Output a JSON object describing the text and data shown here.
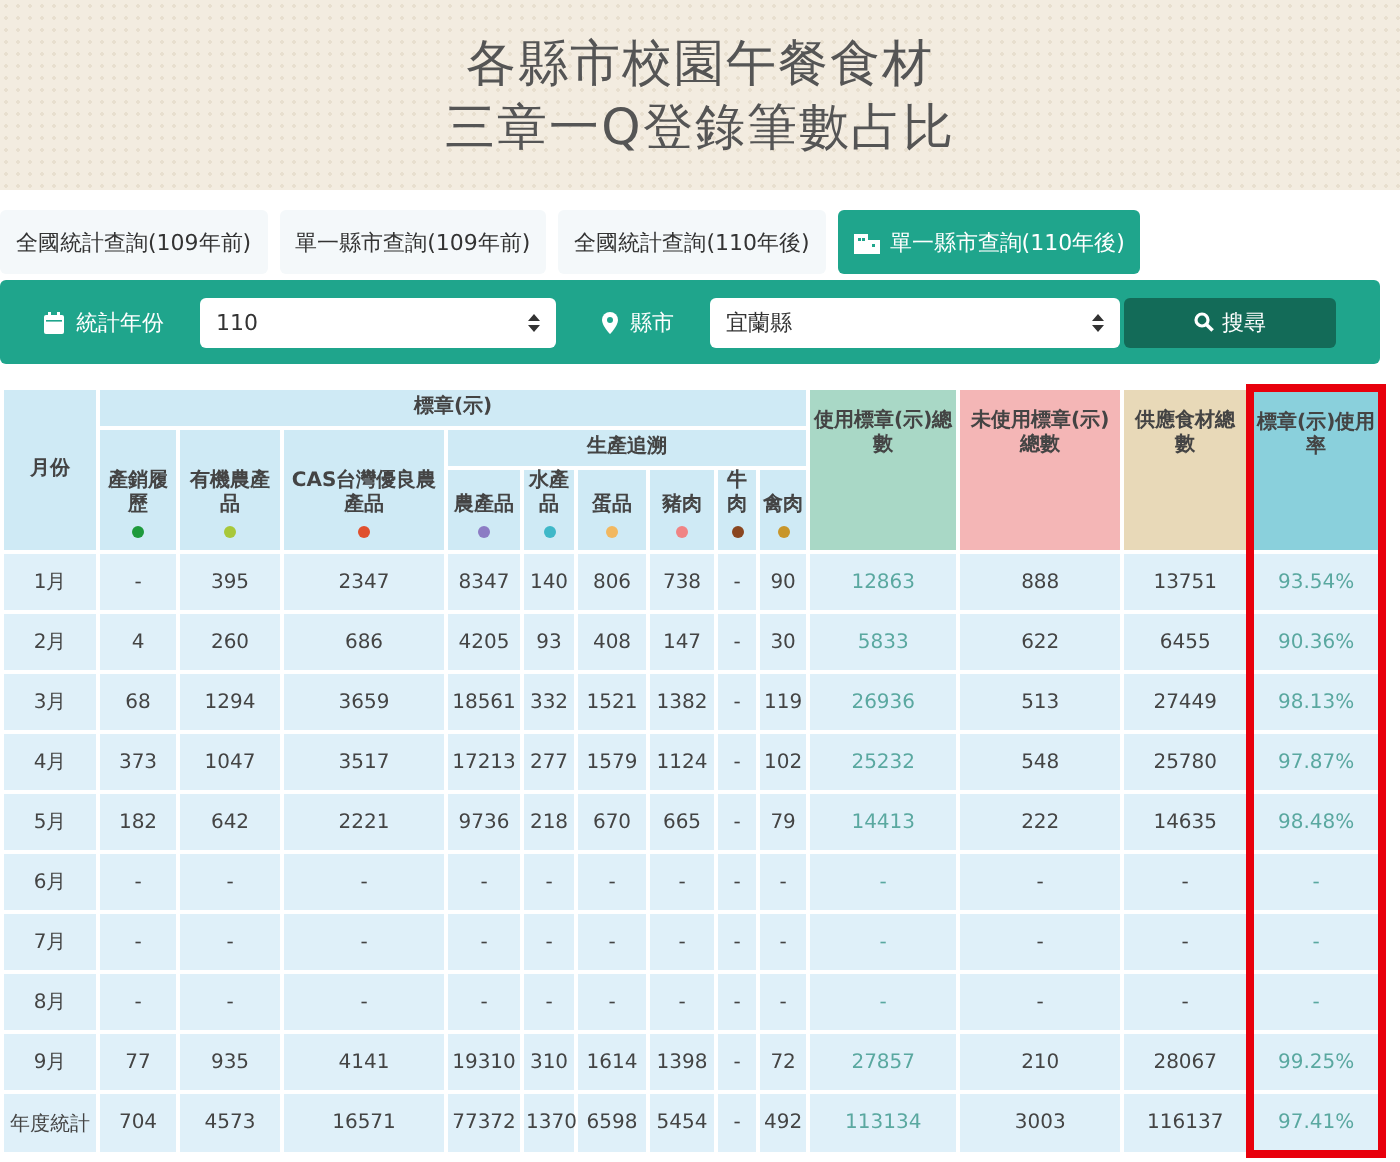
{
  "banner": {
    "title_lines": [
      "各縣市校園午餐食材",
      "三章一Q登錄筆數占比"
    ]
  },
  "tabs": [
    {
      "label": "全國統計查詢(109年前)",
      "selected": false
    },
    {
      "label": "單一縣市查詢(109年前)",
      "selected": false
    },
    {
      "label": "全國統計查詢(110年後)",
      "selected": false
    },
    {
      "label": "單一縣市查詢(110年後)",
      "selected": true
    }
  ],
  "filter": {
    "year_label": "統計年份",
    "year_value": "110",
    "county_label": "縣市",
    "county_value": "宜蘭縣",
    "search_button": "搜尋"
  },
  "table": {
    "month_heading": "月份",
    "group_heading": "標章(示)",
    "subgroup_heading": "生產追溯",
    "label_columns": [
      {
        "name": "產銷履歷",
        "color": "#1e9a3c"
      },
      {
        "name": "有機農產品",
        "color": "#a8c83a"
      },
      {
        "name": "CAS台灣優良農產品",
        "color": "#e0502e"
      }
    ],
    "trace_columns": [
      {
        "name": "農產品",
        "color": "#8c7cc4"
      },
      {
        "name": "水產品",
        "color": "#3fb8c8"
      },
      {
        "name": "蛋品",
        "color": "#f2b860"
      },
      {
        "name": "豬肉",
        "color": "#f08484"
      },
      {
        "name": "牛肉",
        "color": "#8a4620"
      },
      {
        "name": "禽肉",
        "color": "#c8962a"
      }
    ],
    "summary_columns": [
      {
        "name": "使用標章(示)總數",
        "kind": "used",
        "highlighted": false
      },
      {
        "name": "未使用標章(示)總數",
        "kind": "unused",
        "highlighted": false
      },
      {
        "name": "供應食材總數",
        "kind": "supply",
        "highlighted": false
      },
      {
        "name": "標章(示)使用率",
        "kind": "rate",
        "highlighted": true
      }
    ],
    "rows": [
      {
        "month": "1月",
        "values": [
          "-",
          "395",
          "2347",
          "8347",
          "140",
          "806",
          "738",
          "-",
          "90",
          "12863",
          "888",
          "13751",
          "93.54%"
        ]
      },
      {
        "month": "2月",
        "values": [
          "4",
          "260",
          "686",
          "4205",
          "93",
          "408",
          "147",
          "-",
          "30",
          "5833",
          "622",
          "6455",
          "90.36%"
        ]
      },
      {
        "month": "3月",
        "values": [
          "68",
          "1294",
          "3659",
          "18561",
          "332",
          "1521",
          "1382",
          "-",
          "119",
          "26936",
          "513",
          "27449",
          "98.13%"
        ]
      },
      {
        "month": "4月",
        "values": [
          "373",
          "1047",
          "3517",
          "17213",
          "277",
          "1579",
          "1124",
          "-",
          "102",
          "25232",
          "548",
          "25780",
          "97.87%"
        ]
      },
      {
        "month": "5月",
        "values": [
          "182",
          "642",
          "2221",
          "9736",
          "218",
          "670",
          "665",
          "-",
          "79",
          "14413",
          "222",
          "14635",
          "98.48%"
        ]
      },
      {
        "month": "6月",
        "values": [
          "-",
          "-",
          "-",
          "-",
          "-",
          "-",
          "-",
          "-",
          "-",
          "-",
          "-",
          "-",
          "-"
        ]
      },
      {
        "month": "7月",
        "values": [
          "-",
          "-",
          "-",
          "-",
          "-",
          "-",
          "-",
          "-",
          "-",
          "-",
          "-",
          "-",
          "-"
        ]
      },
      {
        "month": "8月",
        "values": [
          "-",
          "-",
          "-",
          "-",
          "-",
          "-",
          "-",
          "-",
          "-",
          "-",
          "-",
          "-",
          "-"
        ]
      },
      {
        "month": "9月",
        "values": [
          "77",
          "935",
          "4141",
          "19310",
          "310",
          "1614",
          "1398",
          "-",
          "72",
          "27857",
          "210",
          "28067",
          "99.25%"
        ]
      },
      {
        "month": "年度統計",
        "values": [
          "704",
          "4573",
          "16571",
          "77372",
          "1370",
          "6598",
          "5454",
          "-",
          "492",
          "113134",
          "3003",
          "116137",
          "97.41%"
        ]
      }
    ]
  }
}
